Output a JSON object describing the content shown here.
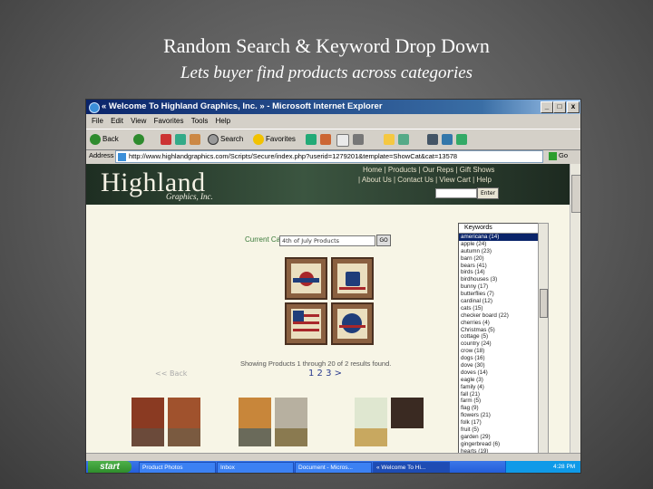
{
  "slide": {
    "title": "Random Search & Keyword Drop Down",
    "subtitle": "Lets buyer find products across categories"
  },
  "window": {
    "title": "« Welcome To Highland Graphics, Inc. » - Microsoft Internet Explorer",
    "buttons": [
      "_",
      "□",
      "x"
    ]
  },
  "menu": [
    "File",
    "Edit",
    "View",
    "Favorites",
    "Tools",
    "Help"
  ],
  "toolbar": {
    "back": "Back",
    "search": "Search",
    "favorites": "Favorites"
  },
  "address": {
    "label": "Address",
    "url": "http://www.highlandgraphics.com/Scripts/Secure/index.php?userid=1279201&template=ShowCat&cat=13578",
    "go": "Go"
  },
  "site": {
    "logo": "Highland",
    "logo_sub": "Graphics, Inc.",
    "nav1": "Home | Products | Our Reps | Gift Shows",
    "nav2": "| About Us | Contact Us | View Cart | Help",
    "search_button": "Enter"
  },
  "category": {
    "label": "Current Category:",
    "value": "4th of July Products",
    "go": "GO"
  },
  "results": {
    "showing": "Showing Products 1 through 20 of 2 results found.",
    "pages": "1 2 3 >",
    "back": "<< Back"
  },
  "keywords": {
    "header": "Keywords",
    "items": [
      "americana (14)",
      "apple (24)",
      "autumn (23)",
      "barn (20)",
      "bears (41)",
      "birds (14)",
      "birdhouses (3)",
      "bunny (17)",
      "butterflies (7)",
      "cardinal (12)",
      "cats (15)",
      "checker board (22)",
      "cherries (4)",
      "Christmas (5)",
      "cottage (5)",
      "country (24)",
      "crow (18)",
      "dogs (16)",
      "dove (30)",
      "doves (14)",
      "eagle (3)",
      "family (4)",
      "fall (21)",
      "farm (5)",
      "flag (9)",
      "flowers (21)",
      "folk (17)",
      "fruit (5)",
      "garden (29)",
      "gingerbread (6)",
      "hearts (19)"
    ]
  },
  "taskbar": {
    "start": "start",
    "tasks": [
      "Product Photos",
      "Inbox",
      "Document - Micros...",
      "« Welcome To Hi..."
    ],
    "clock": "4:28 PM"
  },
  "colors": {
    "accent_red": "#a8272a",
    "banner_green": "#3b5540",
    "titlebar": "#0a246a"
  }
}
